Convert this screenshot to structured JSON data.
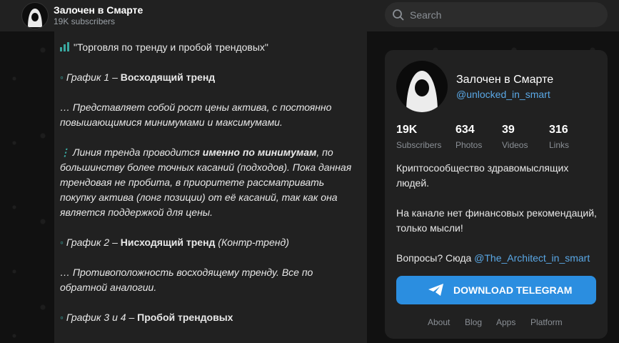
{
  "header": {
    "channel_title": "Залочен в Смарте",
    "subscribers": "19K subscribers",
    "search_placeholder": "Search"
  },
  "post": {
    "headline": "\"Торговля по тренду и пробой трендовых\"",
    "g1_label": "График 1",
    "g1_dash": " – ",
    "g1_title": "Восходящий тренд",
    "p1": "… Представляет собой рост цены актива, с постоянно повышающимися минимумами и максимумами.",
    "p2_a": "Линия тренда проводится ",
    "p2_b": "именно по минимумам",
    "p2_c": ", по большинству более точных касаний (подходов). Пока данная трендовая не пробита, в приоритете рассматривать покупку актива (лонг позиции) от её касаний, так как она является поддержкой для цены.",
    "g2_label": "График 2",
    "g2_dash": " – ",
    "g2_title": "Нисходящий тренд",
    "g2_note": " (Контр-тренд)",
    "p3": "… Противоположность восходящему тренду. Все по обратной аналогии.",
    "g3_label": "График 3 и 4",
    "g3_dash": " – ",
    "g3_title": "Пробой трендовых"
  },
  "card": {
    "title": "Залочен в Смарте",
    "handle": "@unlocked_in_smart",
    "stats": [
      {
        "value": "19K",
        "label": "Subscribers"
      },
      {
        "value": "634",
        "label": "Photos"
      },
      {
        "value": "39",
        "label": "Videos"
      },
      {
        "value": "316",
        "label": "Links"
      }
    ],
    "desc1": "Криптосообщество здравомыслящих людей.",
    "desc2": "На канале нет финансовых рекомендаций, только мысли!",
    "desc3_text": "Вопросы? Сюда ",
    "desc3_link": "@The_Architect_in_smart",
    "download_label": "DOWNLOAD TELEGRAM",
    "footer": [
      "About",
      "Blog",
      "Apps",
      "Platform"
    ]
  },
  "colors": {
    "accent": "#2b8ee0",
    "link": "#5aa8e6",
    "bullet": "#3aa8a0"
  }
}
